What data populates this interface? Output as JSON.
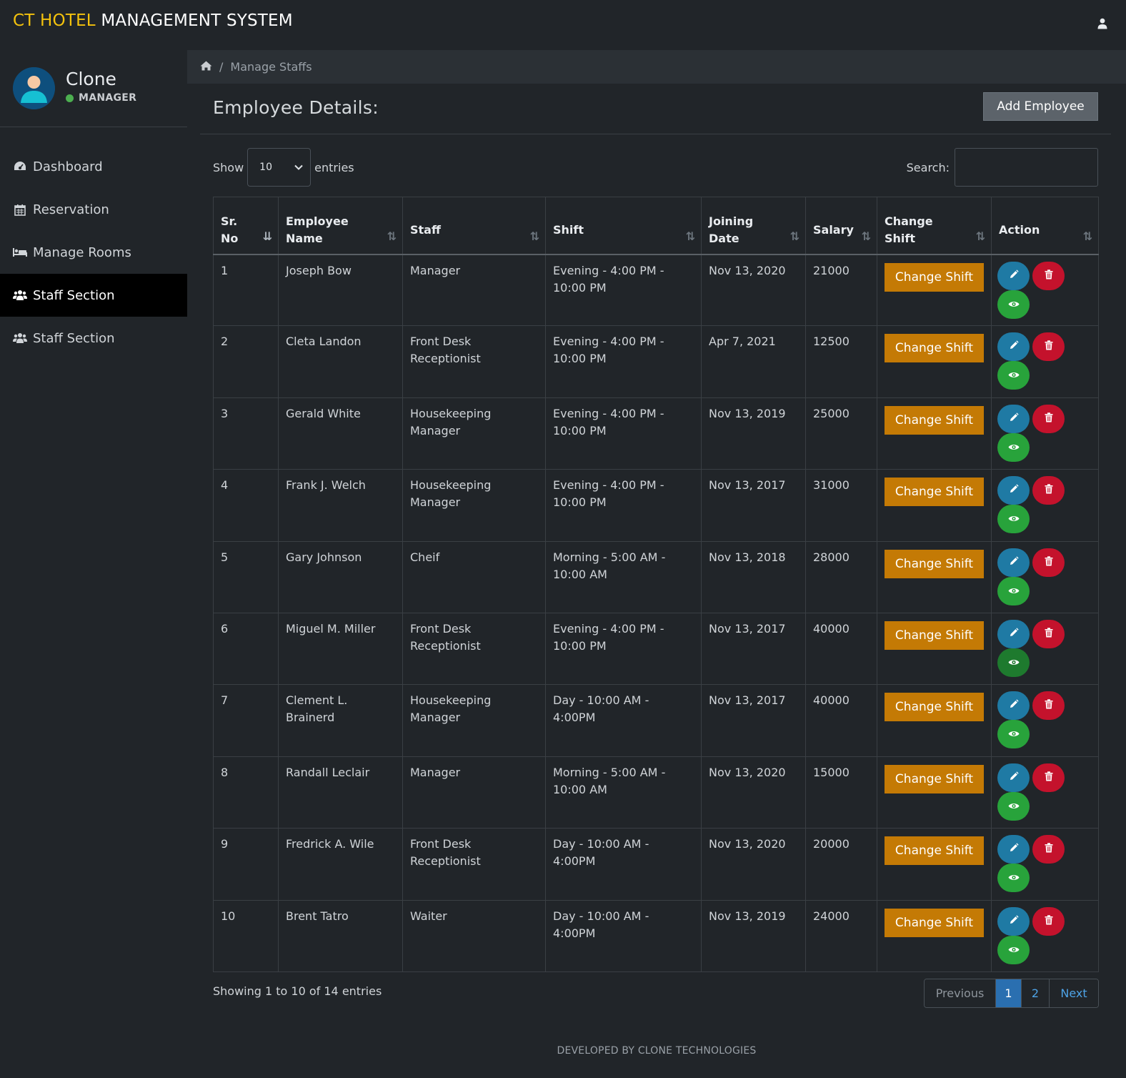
{
  "brand": {
    "accent": "CT HOTEL",
    "rest": "MANAGEMENT SYSTEM"
  },
  "profile": {
    "name": "Clone",
    "role": "MANAGER"
  },
  "nav": [
    {
      "label": "Dashboard",
      "icon": "dashboard-icon"
    },
    {
      "label": "Reservation",
      "icon": "calendar-icon"
    },
    {
      "label": "Manage Rooms",
      "icon": "bed-icon"
    },
    {
      "label": "Staff Section",
      "icon": "users-icon",
      "active": true
    },
    {
      "label": "Staff Section",
      "icon": "users-icon"
    }
  ],
  "breadcrumb": {
    "current": "Manage Staffs"
  },
  "page": {
    "title": "Employee Details:",
    "add_label": "Add Employee"
  },
  "length": {
    "show": "Show",
    "value": "10",
    "entries": "entries"
  },
  "search": {
    "label": "Search:",
    "value": ""
  },
  "table": {
    "headers": [
      [
        "Sr.",
        "No"
      ],
      [
        "Employee",
        "Name"
      ],
      [
        "Staff"
      ],
      [
        "Shift"
      ],
      [
        "Joining",
        "Date"
      ],
      [
        "Salary"
      ],
      [
        "Change",
        "Shift"
      ],
      [
        "Action"
      ]
    ],
    "change_shift_label": "Change Shift",
    "rows": [
      {
        "no": "1",
        "name": "Joseph Bow",
        "staff": "Manager",
        "shift": "Evening - 4:00 PM - 10:00 PM",
        "date": "Nov 13, 2020",
        "salary": "21000"
      },
      {
        "no": "2",
        "name": "Cleta Landon",
        "staff": "Front Desk Receptionist",
        "shift": "Evening - 4:00 PM - 10:00 PM",
        "date": "Apr 7, 2021",
        "salary": "12500"
      },
      {
        "no": "3",
        "name": "Gerald White",
        "staff": "Housekeeping Manager",
        "shift": "Evening - 4:00 PM - 10:00 PM",
        "date": "Nov 13, 2019",
        "salary": "25000"
      },
      {
        "no": "4",
        "name": "Frank J. Welch",
        "staff": "Housekeeping Manager",
        "shift": "Evening - 4:00 PM - 10:00 PM",
        "date": "Nov 13, 2017",
        "salary": "31000"
      },
      {
        "no": "5",
        "name": "Gary Johnson",
        "staff": "Cheif",
        "shift": "Morning - 5:00 AM - 10:00 AM",
        "date": "Nov 13, 2018",
        "salary": "28000"
      },
      {
        "no": "6",
        "name": "Miguel M. Miller",
        "staff": "Front Desk Receptionist",
        "shift": "Evening - 4:00 PM - 10:00 PM",
        "date": "Nov 13, 2017",
        "salary": "40000"
      },
      {
        "no": "7",
        "name": "Clement L. Brainerd",
        "staff": "Housekeeping Manager",
        "shift": "Day - 10:00 AM - 4:00PM",
        "date": "Nov 13, 2017",
        "salary": "40000"
      },
      {
        "no": "8",
        "name": "Randall Leclair",
        "staff": "Manager",
        "shift": "Morning - 5:00 AM - 10:00 AM",
        "date": "Nov 13, 2020",
        "salary": "15000"
      },
      {
        "no": "9",
        "name": "Fredrick A. Wile",
        "staff": "Front Desk Receptionist",
        "shift": "Day - 10:00 AM - 4:00PM",
        "date": "Nov 13, 2020",
        "salary": "20000"
      },
      {
        "no": "10",
        "name": "Brent Tatro",
        "staff": "Waiter",
        "shift": "Day - 10:00 AM - 4:00PM",
        "date": "Nov 13, 2019",
        "salary": "24000"
      }
    ]
  },
  "info": "Showing 1 to 10 of 14 entries",
  "pagination": {
    "previous": "Previous",
    "pages": [
      "1",
      "2"
    ],
    "current": "1",
    "next": "Next"
  },
  "footer": "DEVELOPED BY CLONE TECHNOLOGIES",
  "colors": {
    "accent": "#f4c20d",
    "change_shift": "#c47a05",
    "edit": "#1f7aa4",
    "delete": "#c4122c",
    "view": "#28a33b",
    "active_page": "#2a6fb0"
  }
}
